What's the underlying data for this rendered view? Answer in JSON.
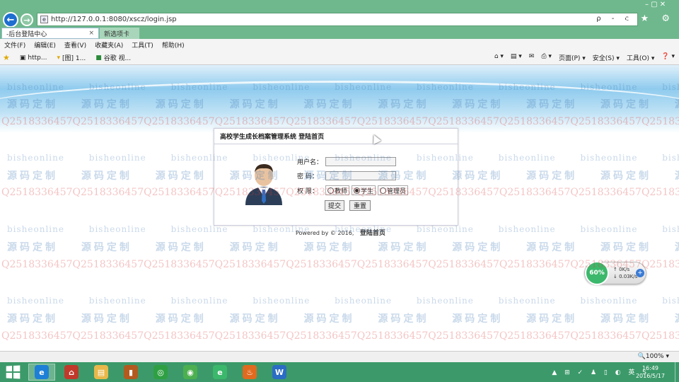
{
  "browser": {
    "url": "http://127.0.0.1:8080/xscz/login.jsp",
    "address_tools": "ρ - c",
    "window_controls": "– ▢ ✕",
    "right_icons": "⌂ ★ ⚙",
    "tabs": [
      {
        "title": "-后台登陆中心",
        "close": "×"
      },
      {
        "title": "新选项卡"
      }
    ],
    "menu": [
      "文件(F)",
      "编辑(E)",
      "查看(V)",
      "收藏夹(A)",
      "工具(T)",
      "帮助(H)"
    ],
    "favorites": [
      {
        "label": "http..."
      },
      {
        "label": "[图] 1..."
      },
      {
        "label": "谷歌 视..."
      }
    ],
    "command_bar": [
      "⌂ ▾",
      "▤ ▾",
      "✉",
      "⎙ ▾",
      "页面(P) ▾",
      "安全(S) ▾",
      "工具(O) ▾",
      "❓ ▾"
    ],
    "zoom": "🔍100% ▾"
  },
  "watermark": {
    "site": "bisheonline",
    "custom": "源码定制",
    "qq": "Q2518336457"
  },
  "login": {
    "title": "高校学生成长档案管理系统 登陆首页",
    "username_label": "用户名：",
    "username_value": "",
    "password_label": "密  码：",
    "password_value": "",
    "role_label": "权  限：",
    "roles": [
      {
        "label": "教师",
        "selected": false
      },
      {
        "label": "学生",
        "selected": true
      },
      {
        "label": "管理员",
        "selected": false
      }
    ],
    "submit_label": "提交",
    "reset_label": "重置",
    "footer_text": "Powered by © 2016,",
    "footer_link": "登陆首页"
  },
  "net_widget": {
    "percent": "60%",
    "up": "↑   0K/s",
    "down": "↓   0.03K/s"
  },
  "taskbar": {
    "clock_time": "16:49",
    "clock_date": "2016/5/17",
    "tray_text": "▲ ⊞ ✓ ♟ ▯ ◐ 英 S",
    "apps": [
      {
        "name": "ie",
        "glyph": "e",
        "color": "#1e7fd6",
        "active": true
      },
      {
        "name": "store",
        "glyph": "⌂",
        "color": "#c0392b",
        "active": false
      },
      {
        "name": "explorer",
        "glyph": "▤",
        "color": "#e8b84a",
        "active": false
      },
      {
        "name": "book",
        "glyph": "▮",
        "color": "#b35a1f",
        "active": false
      },
      {
        "name": "iqiyi",
        "glyph": "◎",
        "color": "#2ea043",
        "active": false
      },
      {
        "name": "wechat",
        "glyph": "◉",
        "color": "#4caf50",
        "active": false
      },
      {
        "name": "browser360",
        "glyph": "e",
        "color": "#3bb86b",
        "active": false
      },
      {
        "name": "java",
        "glyph": "♨",
        "color": "#e06a1f",
        "active": false
      },
      {
        "name": "word",
        "glyph": "W",
        "color": "#2b6cc4",
        "active": false
      }
    ]
  }
}
